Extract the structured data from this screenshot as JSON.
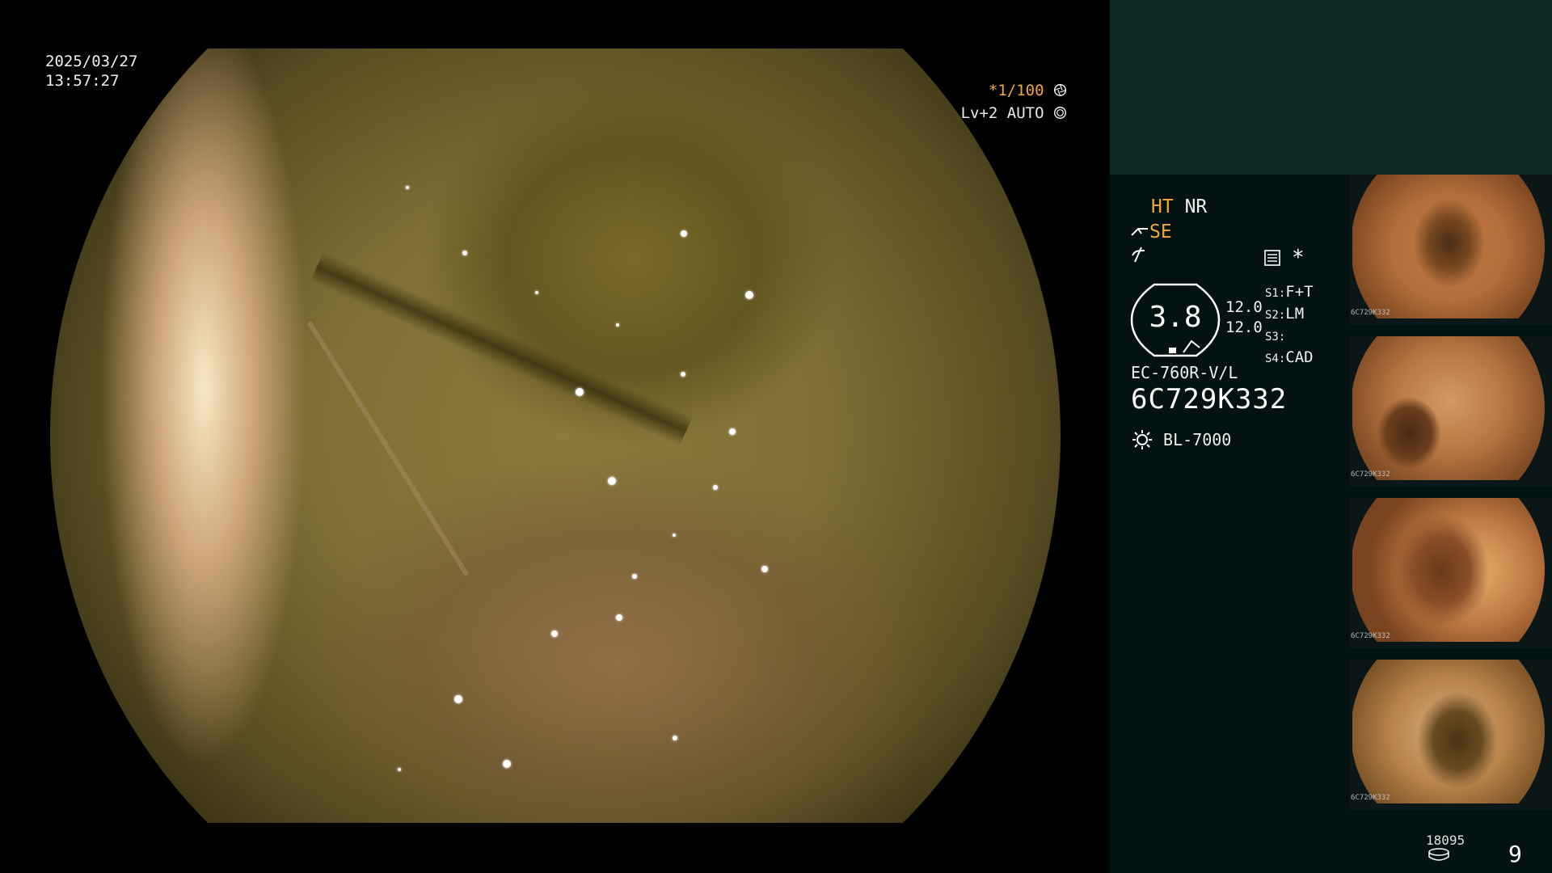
{
  "main_view": {
    "date": "2025/03/27",
    "time": "13:57:27",
    "shutter": "*1/100",
    "level": "Lv+2 AUTO"
  },
  "panel": {
    "enhancement": {
      "ht": "HT",
      "nr": "NR",
      "se": "SE"
    },
    "gauge_value": "3.8",
    "side_values": [
      "12.0",
      "12.0"
    ],
    "scope_settings": [
      {
        "key": "S1",
        "value": "F+T"
      },
      {
        "key": "S2",
        "value": "LM"
      },
      {
        "key": "S3",
        "value": ""
      },
      {
        "key": "S4",
        "value": "CAD"
      }
    ],
    "model": "EC-760R-V/L",
    "serial": "6C729K332",
    "light_source": "BL-7000",
    "thumbnails": [
      {
        "id": "6C729K332"
      },
      {
        "id": "6C729K332"
      },
      {
        "id": "6C729K332"
      },
      {
        "id": "6C729K332"
      }
    ],
    "storage_count": "18095",
    "capture_count": "9"
  },
  "colors": {
    "accent_orange": "#f2a640",
    "panel_bg": "#041312",
    "panel_top_bg": "#0c2926"
  },
  "icons": [
    "aperture-icon",
    "auto-iris-icon",
    "scope-icon",
    "wire-icon",
    "settings-box-icon",
    "star-icon",
    "lamp-icon",
    "disk-icon"
  ]
}
